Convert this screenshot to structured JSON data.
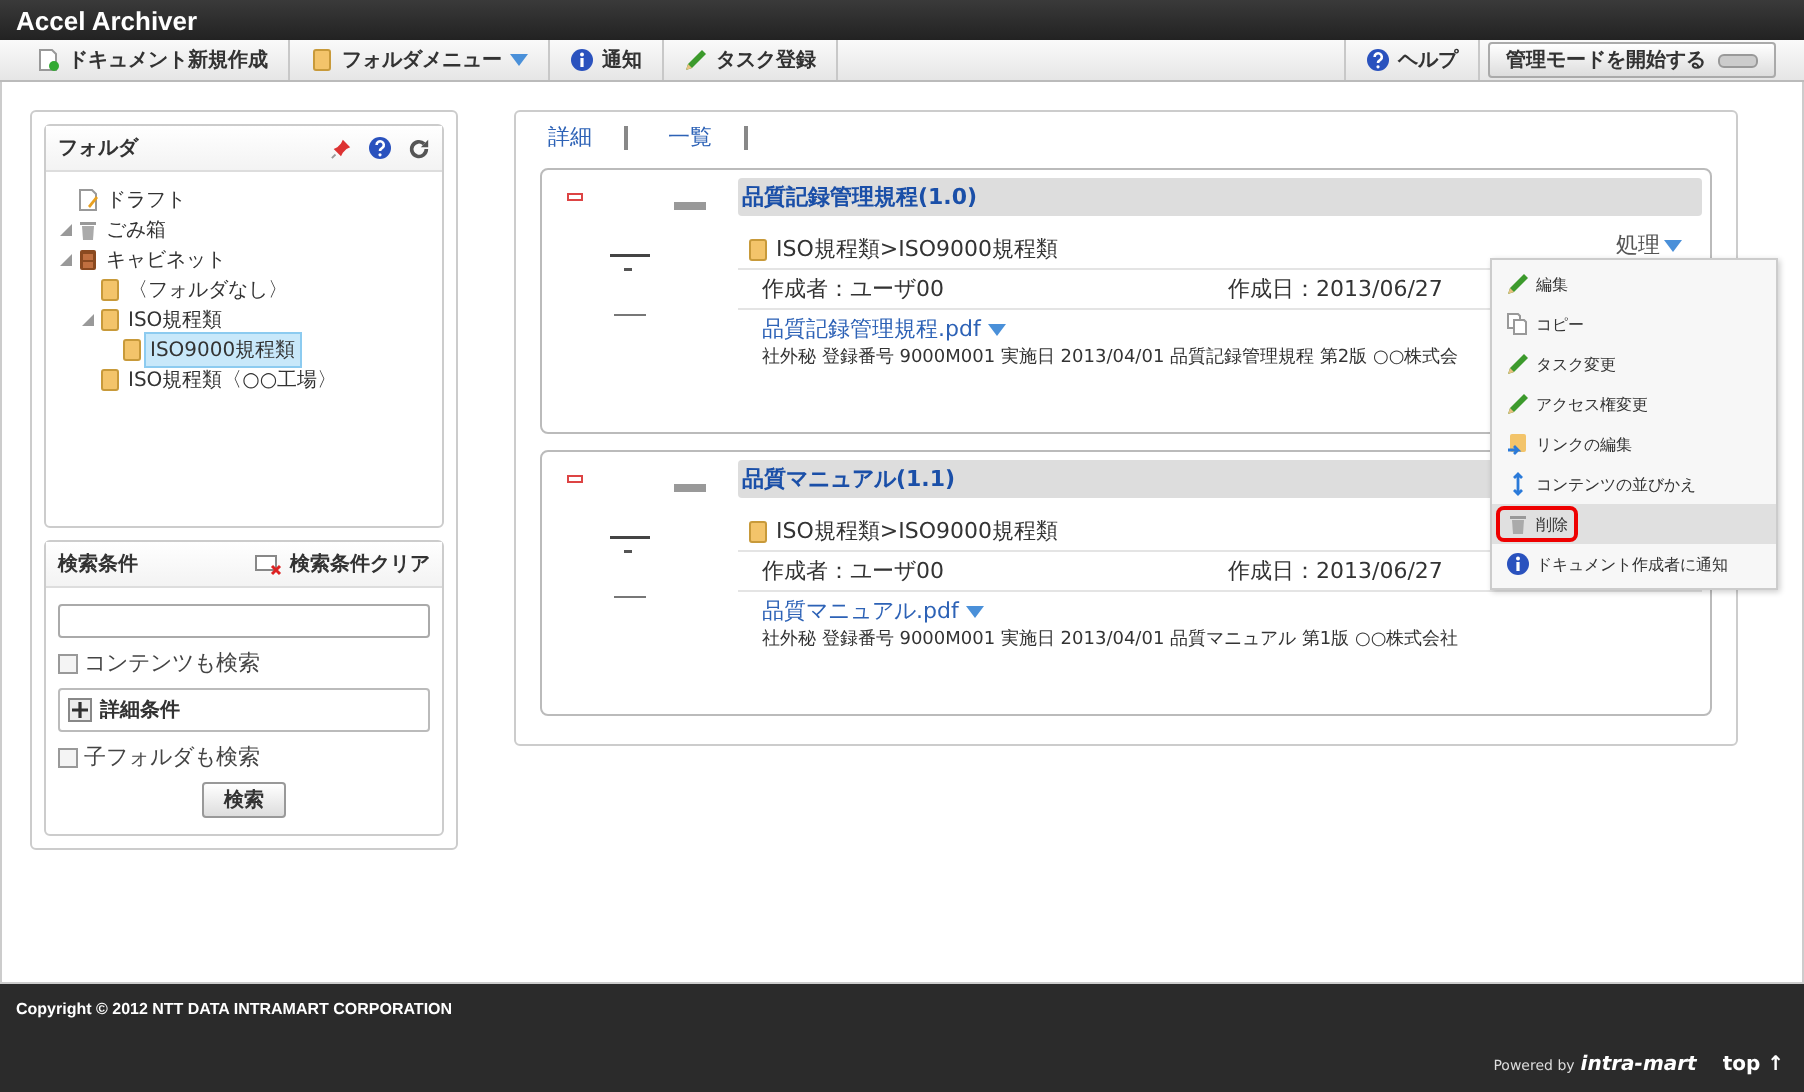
{
  "app_title": "Accel Archiver",
  "toolbar": {
    "left": [
      {
        "label": "ドキュメント新規作成",
        "kind": "new-doc",
        "dropdown": false
      },
      {
        "label": "フォルダメニュー",
        "kind": "folder",
        "dropdown": true
      },
      {
        "label": "通知",
        "kind": "info",
        "dropdown": false
      },
      {
        "label": "タスク登録",
        "kind": "task",
        "dropdown": false
      }
    ],
    "help": "ヘルプ",
    "admin_button": "管理モードを開始する"
  },
  "folder_panel": {
    "title": "フォルダ",
    "tree": [
      {
        "label": "ドラフト",
        "kind": "draft",
        "selected": false
      },
      {
        "label": "ごみ箱",
        "kind": "trash",
        "expanded": true,
        "selected": false
      },
      {
        "label": "キャビネット",
        "kind": "cabinet",
        "expanded": true,
        "selected": false,
        "children": [
          {
            "label": "〈フォルダなし〉",
            "kind": "folder",
            "selected": false
          },
          {
            "label": "ISO規程類",
            "kind": "folder",
            "expanded": true,
            "selected": false,
            "children": [
              {
                "label": "ISO9000規程類",
                "kind": "folder",
                "selected": true
              }
            ]
          },
          {
            "label": "ISO規程類〈○○工場〉",
            "kind": "folder",
            "selected": false
          }
        ]
      }
    ]
  },
  "search_panel": {
    "title": "検索条件",
    "clear": "検索条件クリア",
    "options": [
      {
        "label": "コンテンツも検索",
        "checked": false
      }
    ],
    "detail": "詳細条件",
    "subfolder": {
      "label": "子フォルダも検索",
      "checked": false
    },
    "button": "検索"
  },
  "view_tabs": [
    {
      "label": "詳細"
    },
    {
      "label": "一覧"
    }
  ],
  "documents": [
    {
      "title": "品質記録管理規程(1.0)",
      "path": "ISO規程類>ISO9000規程類",
      "author": "作成者：ユーザ00",
      "date": "作成日：2013/06/27",
      "file": "品質記録管理規程.pdf",
      "summary": "社外秘  登録番号 9000M001  実施日 2013/04/01 品質記録管理規程 第2版 ○○株式会",
      "action": "処理"
    },
    {
      "title": "品質マニュアル(1.1)",
      "path": "ISO規程類>ISO9000規程類",
      "author": "作成者：ユーザ00",
      "date": "作成日：2013/06/27",
      "file": "品質マニュアル.pdf",
      "summary": "社外秘  登録番号 9000M001  実施日 2013/04/01 品質マニュアル 第1版 ○○株式会社"
    }
  ],
  "action_menu": [
    {
      "label": "編集",
      "kind": "pencil",
      "selected": false
    },
    {
      "label": "コピー",
      "kind": "copy",
      "selected": false
    },
    {
      "label": "タスク変更",
      "kind": "pencil",
      "selected": false
    },
    {
      "label": "アクセス権変更",
      "kind": "pencil",
      "selected": false
    },
    {
      "label": "リンクの編集",
      "kind": "link",
      "selected": false
    },
    {
      "label": "コンテンツの並びかえ",
      "kind": "sort",
      "selected": false
    },
    {
      "label": "削除",
      "kind": "trash",
      "selected": true
    },
    {
      "label": "ドキュメント作成者に通知",
      "kind": "info",
      "selected": false
    }
  ],
  "footer": {
    "copyright": "Copyright © 2012 NTT DATA INTRAMART CORPORATION",
    "powered_by": "Powered by",
    "brand": "intra-mart",
    "top_link": "top ↑"
  }
}
